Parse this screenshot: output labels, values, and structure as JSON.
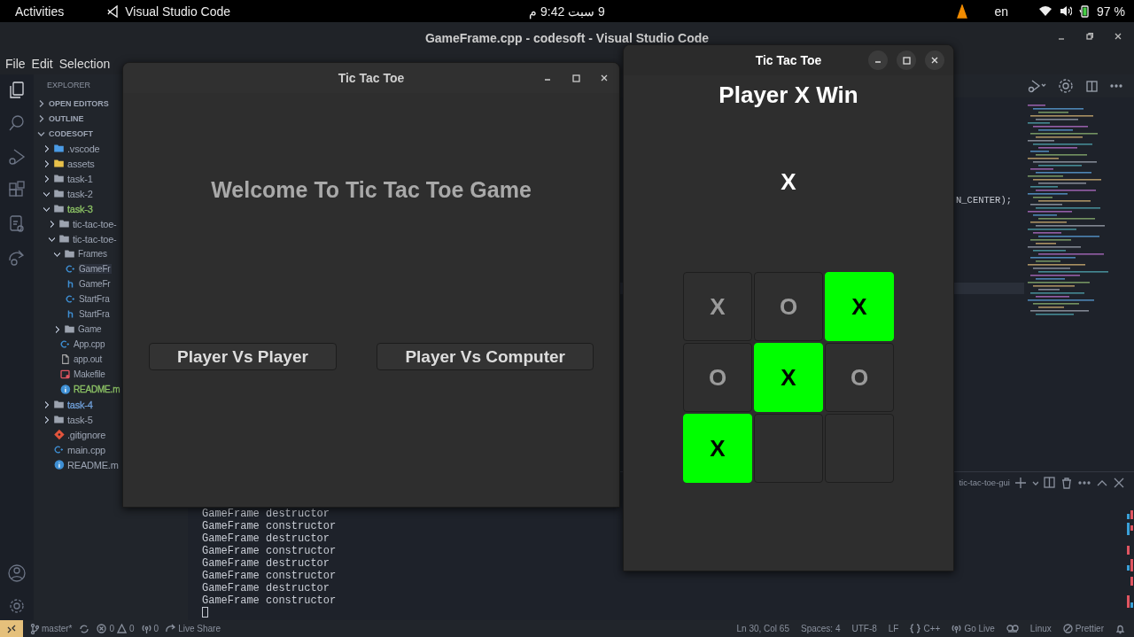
{
  "top_bar": {
    "activities": "Activities",
    "app": "Visual Studio Code",
    "clock": "9 سبت  9:42 م",
    "language": "en",
    "battery": "97 %"
  },
  "vscode": {
    "title": "GameFrame.cpp - codesoft - Visual Studio Code",
    "menu": [
      "File",
      "Edit",
      "Selection"
    ],
    "explorer": {
      "title": "EXPLORER",
      "sections": [
        {
          "label": "OPEN EDITORS",
          "expanded": false
        },
        {
          "label": "OUTLINE",
          "expanded": false
        },
        {
          "label": "CODESOFT",
          "expanded": true
        }
      ],
      "tree": [
        {
          "label": ".vscode",
          "kind": "config",
          "expanded": false,
          "selected": false
        },
        {
          "label": "assets",
          "kind": "assets",
          "expanded": false,
          "selected": false
        },
        {
          "label": "task-1",
          "kind": "folder",
          "expanded": false,
          "selected": false
        },
        {
          "label": "task-2",
          "kind": "folder",
          "expanded": true,
          "selected": false
        },
        {
          "label": "task-3",
          "kind": "folder",
          "expanded": true,
          "selected": false,
          "color": "#8cc265",
          "children": [
            {
              "label": "tic-tac-toe-",
              "kind": "folder",
              "expanded": false,
              "selected": false
            },
            {
              "label": "tic-tac-toe-",
              "kind": "folder",
              "expanded": true,
              "selected": false,
              "children": [
                {
                  "label": "Frames",
                  "kind": "folder",
                  "expanded": true,
                  "selected": false,
                  "children": [
                    {
                      "label": "GameFr",
                      "kind": "cpp",
                      "selected": true
                    },
                    {
                      "label": "GameFr",
                      "kind": "header",
                      "selected": false
                    },
                    {
                      "label": "StartFra",
                      "kind": "cpp",
                      "selected": false
                    },
                    {
                      "label": "StartFra",
                      "kind": "header",
                      "selected": false
                    }
                  ]
                },
                {
                  "label": "Game",
                  "kind": "folder",
                  "expanded": false,
                  "selected": false
                },
                {
                  "label": "App.cpp",
                  "kind": "cpp",
                  "selected": false
                },
                {
                  "label": "app.out",
                  "kind": "binary",
                  "selected": false
                },
                {
                  "label": "Makefile",
                  "kind": "makefile",
                  "selected": false
                },
                {
                  "label": "README.m",
                  "kind": "readme",
                  "selected": false,
                  "color": "#8cc265"
                }
              ]
            }
          ]
        },
        {
          "label": "task-4",
          "kind": "folder",
          "expanded": false,
          "selected": false,
          "color": "#6f9fd8"
        },
        {
          "label": "task-5",
          "kind": "folder",
          "expanded": false,
          "selected": false
        },
        {
          "label": ".gitignore",
          "kind": "git",
          "selected": false
        },
        {
          "label": "main.cpp",
          "kind": "cpp",
          "selected": false
        },
        {
          "label": "README.m",
          "kind": "readme",
          "selected": false
        }
      ]
    },
    "editor": {
      "code_fragment": "N_CENTER);"
    },
    "panel": {
      "terminal_name": "tic-tac-toe-gui",
      "terminal_lines": [
        "GameFrame destructor",
        "GameFrame constructor",
        "GameFrame destructor",
        "GameFrame constructor",
        "GameFrame destructor",
        "GameFrame constructor",
        "GameFrame destructor",
        "GameFrame constructor"
      ]
    },
    "status_bar": {
      "branch": "master*",
      "errors": "0",
      "warnings": "0",
      "ports": "0",
      "live_share": "Live Share",
      "position": "Ln 30, Col 65",
      "spaces": "Spaces: 4",
      "encoding": "UTF-8",
      "eol": "LF",
      "language": "C++",
      "go_live": "Go Live",
      "os": "Linux",
      "prettier": "Prettier"
    }
  },
  "windows": [
    {
      "kind": "start",
      "title": "Tic Tac Toe",
      "focused": false,
      "heading": "Welcome To Tic Tac Toe Game",
      "buttons": [
        "Player Vs Player",
        "Player Vs Computer"
      ]
    },
    {
      "kind": "game",
      "title": "Tic Tac Toe",
      "focused": true,
      "status": "Player X Win",
      "turn": "X",
      "board": [
        {
          "mark": "X",
          "highlighted": false
        },
        {
          "mark": "O",
          "highlighted": false
        },
        {
          "mark": "X",
          "highlighted": true
        },
        {
          "mark": "O",
          "highlighted": false
        },
        {
          "mark": "X",
          "highlighted": true
        },
        {
          "mark": "O",
          "highlighted": false
        },
        {
          "mark": "X",
          "highlighted": true
        },
        {
          "highlighted": false
        },
        {
          "highlighted": false
        }
      ]
    }
  ]
}
